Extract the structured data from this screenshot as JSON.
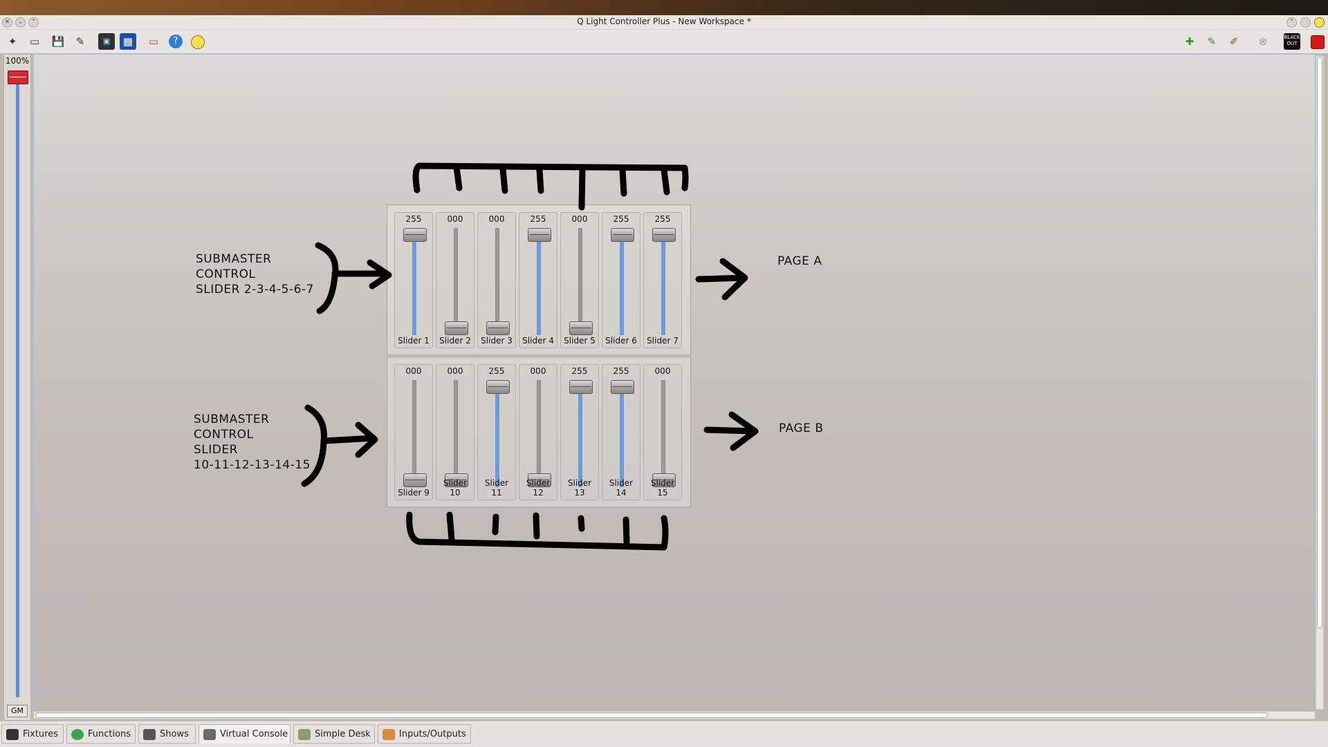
{
  "window": {
    "title": "Q Light Controller Plus - New Workspace *"
  },
  "toolbar": {
    "left_icons": [
      "new-icon",
      "open-icon",
      "save-icon",
      "save-as-icon",
      "monitor-icon",
      "address-tool-icon",
      "full-screen-icon",
      "help-icon",
      "about-icon"
    ],
    "right_icons": [
      "operate-mode-icon",
      "edit-mode-icon",
      "design-mode-icon",
      "stop-all-icon",
      "blackout-icon",
      "close-red-icon"
    ],
    "blackout_label": "BLACK OUT"
  },
  "grand_master": {
    "percent": "100%",
    "label": "GM",
    "level": 1.0
  },
  "page_a": {
    "sliders": [
      {
        "value": "255",
        "name": "Slider 1"
      },
      {
        "value": "000",
        "name": "Slider 2"
      },
      {
        "value": "000",
        "name": "Slider 3"
      },
      {
        "value": "255",
        "name": "Slider 4"
      },
      {
        "value": "000",
        "name": "Slider 5"
      },
      {
        "value": "255",
        "name": "Slider 6"
      },
      {
        "value": "255",
        "name": "Slider 7"
      }
    ]
  },
  "page_b": {
    "sliders": [
      {
        "value": "000",
        "name": "Slider 9"
      },
      {
        "value": "000",
        "name": "Slider 10"
      },
      {
        "value": "255",
        "name": "Slider 11"
      },
      {
        "value": "000",
        "name": "Slider 12"
      },
      {
        "value": "255",
        "name": "Slider 13"
      },
      {
        "value": "255",
        "name": "Slider 14"
      },
      {
        "value": "000",
        "name": "Slider 15"
      }
    ]
  },
  "annotations": {
    "submaster_a": [
      "SUBMASTER",
      "CONTROL",
      "SLIDER 2-3-4-5-6-7"
    ],
    "submaster_b": [
      "SUBMASTER",
      "CONTROL",
      "SLIDER",
      "10-11-12-13-14-15"
    ],
    "page_a_label": "PAGE A",
    "page_b_label": "PAGE B"
  },
  "tabs": [
    {
      "label": "Fixtures",
      "icon": "fixtures-icon"
    },
    {
      "label": "Functions",
      "icon": "functions-icon"
    },
    {
      "label": "Shows",
      "icon": "shows-icon"
    },
    {
      "label": "Virtual Console",
      "icon": "virtual-console-icon"
    },
    {
      "label": "Simple Desk",
      "icon": "simple-desk-icon"
    },
    {
      "label": "Inputs/Outputs",
      "icon": "inputs-outputs-icon"
    }
  ],
  "active_tab": "Virtual Console"
}
